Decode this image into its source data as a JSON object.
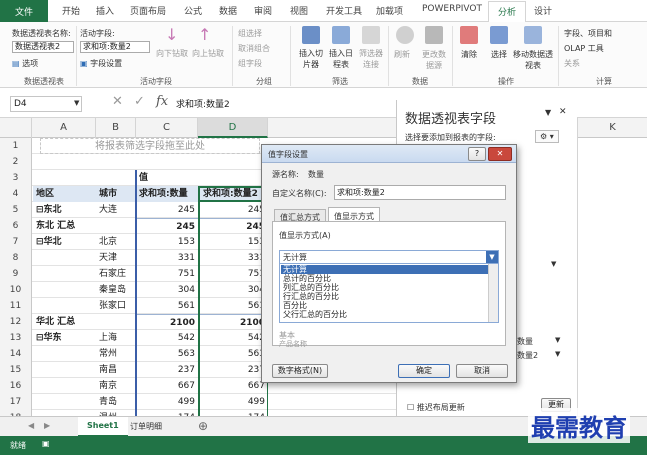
{
  "app": {
    "ribbon_tabs": [
      "文件",
      "开始",
      "插入",
      "页面布局",
      "公式",
      "数据",
      "审阅",
      "视图",
      "开发工具",
      "加载项",
      "POWERPIVOT",
      "分析",
      "设计"
    ],
    "active_tab": "分析",
    "accent_color": "#217346"
  },
  "ribbon": {
    "pivot_name_label": "数据透视表名称:",
    "pivot_name_value": "数据透视表2",
    "options_label": "选项",
    "active_field_label": "活动字段:",
    "active_field_value": "求和项:数量2",
    "field_settings_label": "字段设置",
    "drill_down": "向下钻取",
    "drill_up": "向上钻取",
    "group_selection": "组选择",
    "ungroup": "取消组合",
    "group_field": "组字段",
    "insert_slicer": "插入切片器",
    "insert_timeline": "插入日程表",
    "filter_connections": "筛选器连接",
    "refresh": "刷新",
    "change_source": "更改数据源",
    "clear": "清除",
    "select": "选择",
    "move_pivot": "移动数据透视表",
    "fields_items": "字段、项目和",
    "olap_tools": "OLAP 工具",
    "relationships": "关系",
    "groups": [
      "数据透视表",
      "活动字段",
      "分组",
      "筛选",
      "数据",
      "操作",
      "计算"
    ]
  },
  "formula_bar": {
    "name_box": "D4",
    "fx_symbol": "fx",
    "cancel_symbol": "✕",
    "enter_symbol": "✓",
    "formula": "求和项:数量2"
  },
  "grid": {
    "columns": [
      "A",
      "B",
      "C",
      "D"
    ],
    "banner": "将报表筛选字段拖至此处",
    "value_header": "值",
    "header_row": [
      "地区",
      "城市",
      "求和项:数量",
      "求和项:数量2"
    ],
    "row_numbers": [
      "1",
      "2",
      "3",
      "4",
      "5",
      "6",
      "7",
      "8",
      "9",
      "10",
      "11",
      "12",
      "13",
      "14",
      "15",
      "16",
      "17",
      "18",
      "19"
    ],
    "rows": [
      [
        "东北",
        "大连",
        "245",
        "245"
      ],
      [
        "东北 汇总",
        "",
        "245",
        "245"
      ],
      [
        "华北",
        "北京",
        "153",
        "153"
      ],
      [
        "",
        "天津",
        "331",
        "331"
      ],
      [
        "",
        "石家庄",
        "751",
        "751"
      ],
      [
        "",
        "秦皇岛",
        "304",
        "304"
      ],
      [
        "",
        "张家口",
        "561",
        "561"
      ],
      [
        "华北 汇总",
        "",
        "2100",
        "2100"
      ],
      [
        "华东",
        "上海",
        "542",
        "542"
      ],
      [
        "",
        "常州",
        "563",
        "563"
      ],
      [
        "",
        "南昌",
        "237",
        "237"
      ],
      [
        "",
        "南京",
        "667",
        "667"
      ],
      [
        "",
        "青岛",
        "499",
        "499"
      ],
      [
        "",
        "温州",
        "174",
        "174"
      ]
    ]
  },
  "pivot_panel": {
    "title": "数据透视表字段",
    "close": "✕",
    "subtitle": "选择要添加到报表的字段:",
    "areas_item1": "数量",
    "areas_item2": "数量2",
    "defer_update": "推迟布局更新",
    "update_button": "更新",
    "col_k": "K"
  },
  "dialog": {
    "title": "值字段设置",
    "help": "?",
    "close": "✕",
    "source_name_label": "源名称:",
    "source_name_value": "数量",
    "custom_name_label": "自定义名称(C):",
    "custom_name_value": "求和项:数量2",
    "tab_summarize": "值汇总方式",
    "tab_show_as": "值显示方式",
    "show_values_as_label": "值显示方式(A)",
    "dropdown_value": "无计算",
    "options": [
      "无计算",
      "总计的百分比",
      "列汇总的百分比",
      "行汇总的百分比",
      "百分比",
      "父行汇总的百分比"
    ],
    "base_field_label": "基本",
    "base_field_value": "产品名称",
    "number_format_button": "数字格式(N)",
    "ok_button": "确定",
    "cancel_button": "取消"
  },
  "sheet_tabs": {
    "active": "Sheet1",
    "other": "订单明细",
    "add": "⊕"
  },
  "status_bar": {
    "ready": "就绪"
  },
  "watermark": "最需教育"
}
